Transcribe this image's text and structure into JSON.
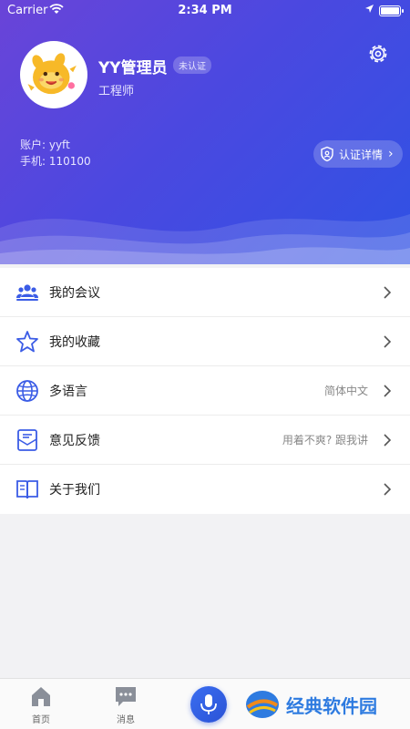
{
  "status_bar": {
    "carrier": "Carrier",
    "time": "2:34 PM"
  },
  "profile": {
    "name": "YY管理员",
    "badge": "未认证",
    "role": "工程师",
    "account": "账户: yyft",
    "phone": "手机: 110100",
    "verify_label": "认证详情"
  },
  "menu": [
    {
      "label": "我的会议",
      "value": "",
      "icon": "people-icon"
    },
    {
      "label": "我的收藏",
      "value": "",
      "icon": "star-icon"
    },
    {
      "label": "多语言",
      "value": "简体中文",
      "icon": "globe-icon"
    },
    {
      "label": "意见反馈",
      "value": "用着不爽? 跟我讲",
      "icon": "feedback-icon"
    },
    {
      "label": "关于我们",
      "value": "",
      "icon": "book-icon"
    }
  ],
  "tabbar": {
    "home": "首页",
    "messages": "消息"
  },
  "watermark": {
    "text": "经典软件园"
  },
  "colors": {
    "accent": "#3b5ce6",
    "header_start": "#6a44d8",
    "header_end": "#2f52e4"
  }
}
